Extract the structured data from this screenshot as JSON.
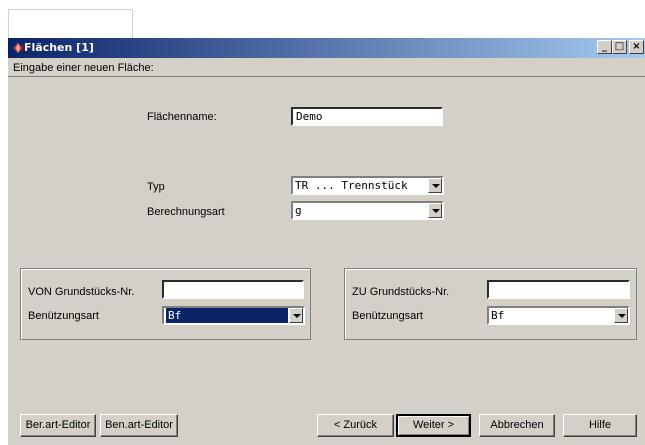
{
  "window": {
    "title": "Flächen [1]"
  },
  "subheader": "Eingabe einer neuen Fläche:",
  "form": {
    "flaechenname_label": "Flächenname:",
    "flaechenname_value": "Demo",
    "typ_label": "Typ",
    "typ_value": "TR ... Trennstück",
    "berechnungsart_label": "Berechnungsart",
    "berechnungsart_value": "g"
  },
  "von": {
    "nr_label": "VON Grundstücks-Nr.",
    "nr_value": "",
    "benutzung_label": "Benützungsart",
    "benutzung_value": "Bf"
  },
  "zu": {
    "nr_label": "ZU Grundstücks-Nr.",
    "nr_value": "",
    "benutzung_label": "Benützungsart",
    "benutzung_value": "Bf"
  },
  "buttons": {
    "berart_editor": "Ber.art-Editor",
    "benart_editor": "Ben.art-Editor",
    "zurueck": "< Zurück",
    "weiter": "Weiter >",
    "abbrechen": "Abbrechen",
    "hilfe": "Hilfe"
  },
  "icons": {
    "app": "app-icon",
    "minimize": "minimize-icon",
    "maximize": "maximize-icon",
    "close": "close-icon"
  },
  "colors": {
    "titlebar": "#0a246a",
    "face": "#d4d0c8",
    "selection": "#0a246a"
  }
}
